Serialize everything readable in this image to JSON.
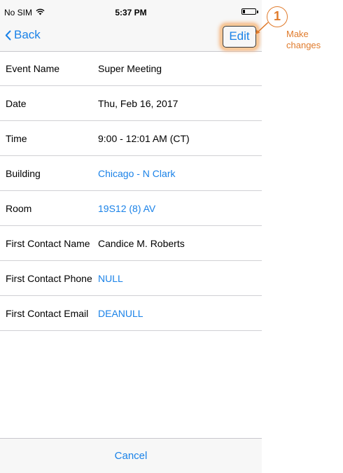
{
  "status": {
    "carrier": "No SIM",
    "time": "5:37 PM"
  },
  "nav": {
    "back_label": "Back",
    "edit_label": "Edit"
  },
  "rows": [
    {
      "label": "Event Name",
      "value": "Super Meeting",
      "link": false
    },
    {
      "label": "Date",
      "value": "Thu, Feb 16, 2017",
      "link": false
    },
    {
      "label": "Time",
      "value": "9:00 - 12:01 AM (CT)",
      "link": false
    },
    {
      "label": "Building",
      "value": "Chicago - N Clark",
      "link": true
    },
    {
      "label": "Room",
      "value": "19S12 (8) AV",
      "link": true
    },
    {
      "label": "First Contact Name",
      "value": "Candice M. Roberts",
      "link": false
    },
    {
      "label": "First Contact Phone",
      "value": "NULL",
      "link": true
    },
    {
      "label": "First Contact Email",
      "value": "DEANULL",
      "link": true
    }
  ],
  "footer": {
    "cancel_label": "Cancel"
  },
  "annotation": {
    "number": "1",
    "lines": [
      "Make",
      "changes"
    ]
  },
  "colors": {
    "accent": "#1a82e8",
    "annotation": "#e07b2c"
  }
}
